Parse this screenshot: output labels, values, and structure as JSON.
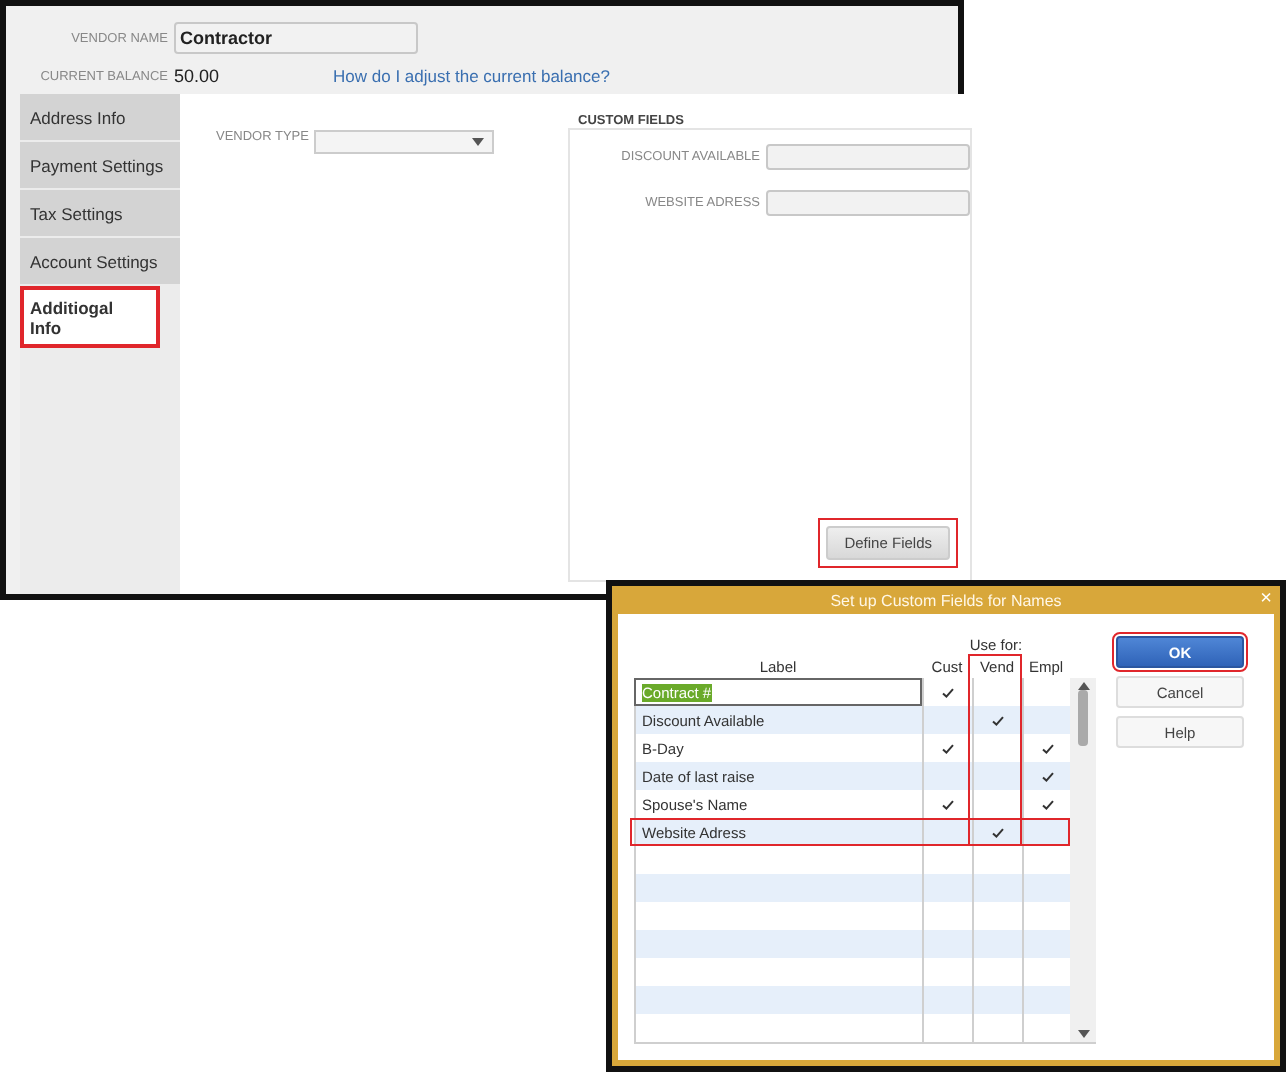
{
  "vendor_name": {
    "label": "VENDOR NAME",
    "value": "Contractor"
  },
  "current_balance": {
    "label": "CURRENT BALANCE",
    "value": "50.00"
  },
  "help_link": "How do I adjust the current balance?",
  "tabs": [
    {
      "label": "Address Info",
      "selected": false,
      "highlighted": false
    },
    {
      "label": "Payment Settings",
      "selected": false,
      "highlighted": false
    },
    {
      "label": "Tax Settings",
      "selected": false,
      "highlighted": false
    },
    {
      "label": "Account Settings",
      "selected": false,
      "highlighted": false
    },
    {
      "label": "Additiogal Info",
      "selected": true,
      "highlighted": true
    }
  ],
  "vendor_type": {
    "label": "VENDOR TYPE"
  },
  "custom_fields": {
    "title": "CUSTOM FIELDS",
    "fields": [
      {
        "label": "DISCOUNT AVAILABLE"
      },
      {
        "label": "WEBSITE ADRESS"
      }
    ],
    "button": {
      "label": "Define Fields",
      "highlighted": true
    }
  },
  "dialog": {
    "title": "Set up Custom Fields for Names",
    "close": "×",
    "group_header": "Use for:",
    "columns": [
      {
        "label": "Label",
        "highlighted": false
      },
      {
        "label": "Cust",
        "highlighted": false
      },
      {
        "label": "Vend",
        "highlighted": true
      },
      {
        "label": "Empl",
        "highlighted": false
      }
    ],
    "rows": [
      {
        "label": "Contract #",
        "selected": true,
        "highlighted": false,
        "use": [
          true,
          false,
          false
        ]
      },
      {
        "label": "Discount Available",
        "selected": false,
        "highlighted": false,
        "use": [
          false,
          true,
          false
        ]
      },
      {
        "label": "B-Day",
        "selected": false,
        "highlighted": false,
        "use": [
          true,
          false,
          true
        ]
      },
      {
        "label": "Date of last raise",
        "selected": false,
        "highlighted": false,
        "use": [
          false,
          false,
          true
        ]
      },
      {
        "label": "Spouse's Name",
        "selected": false,
        "highlighted": false,
        "use": [
          true,
          false,
          true
        ]
      },
      {
        "label": "Website Adress",
        "selected": false,
        "highlighted": true,
        "use": [
          false,
          true,
          false
        ]
      }
    ],
    "buttons": [
      {
        "label": "OK",
        "default": true,
        "highlighted": true
      },
      {
        "label": "Cancel",
        "default": false,
        "highlighted": false
      },
      {
        "label": "Help",
        "default": false,
        "highlighted": false
      }
    ]
  }
}
